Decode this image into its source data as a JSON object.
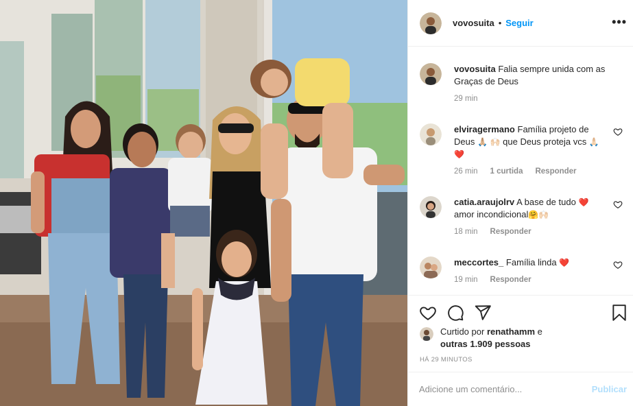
{
  "post": {
    "username": "vovosuita",
    "separator": "•",
    "follow_label": "Seguir",
    "more_label": "•••"
  },
  "caption": {
    "username": "vovosuita",
    "text": "Falia sempre unida com as Graças de Deus",
    "time": "29 min"
  },
  "comments": [
    {
      "username": "elviragermano",
      "text": "Família projeto de Deus",
      "emoji1": "🙏🏼",
      "text2": "que Deus proteja vcs",
      "emoji2": "🙏🏻",
      "emoji3": "❤️",
      "emoji_hands": "🙌🏻",
      "time": "26 min",
      "likes": "1 curtida",
      "reply": "Responder"
    },
    {
      "username": "catia.araujolrv",
      "text": "A base de tudo",
      "emoji1": "❤️",
      "text2": "amor incondicional",
      "emoji2": "🤗",
      "emoji3": "🙌🏻",
      "time": "18 min",
      "reply": "Responder"
    },
    {
      "username": "meccortes_",
      "text": "Família linda",
      "emoji1": "❤️",
      "time": "19 min",
      "reply": "Responder"
    }
  ],
  "likes": {
    "prefix": "Curtido por",
    "user": "renathamm",
    "mid": "e",
    "others": "outras 1.909 pessoas"
  },
  "timestamp": "HÁ 29 MINUTOS",
  "add_comment": {
    "placeholder": "Adicione um comentário...",
    "publish_label": "Publicar"
  },
  "colors": {
    "link": "#0095f6",
    "muted": "#8e8e8e",
    "heart": "#ed4956",
    "publish_disabled": "#b2dffc"
  }
}
